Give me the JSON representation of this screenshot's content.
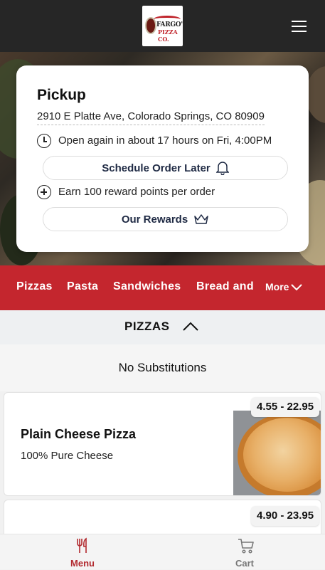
{
  "header": {
    "logo_line1": "FARGO'S",
    "logo_line2": "PIZZA CO.",
    "menu_icon": "hamburger-menu-icon"
  },
  "pickup_card": {
    "title": "Pickup",
    "address": "2910 E Platte Ave, Colorado Springs, CO 80909",
    "hours_text": "Open again in about 17 hours on Fri, 4:00PM",
    "hours_icon": "clock-icon",
    "schedule_button": "Schedule Order Later",
    "schedule_icon": "bell-icon",
    "rewards_text": "Earn 100 reward points per order",
    "rewards_icon": "plus-circle-icon",
    "rewards_button": "Our Rewards",
    "rewards_button_icon": "crown-icon"
  },
  "categories": {
    "items": [
      "Pizzas",
      "Pasta",
      "Sandwiches",
      "Bread and"
    ],
    "more_label": "More",
    "more_icon": "chevron-down-icon"
  },
  "section": {
    "title": "PIZZAS",
    "toggle_icon": "chevron-up-icon",
    "subtitle": "No Substitutions"
  },
  "menu_items": [
    {
      "name": "Plain Cheese Pizza",
      "description": "100% Pure Cheese",
      "price": "4.55 - 22.95"
    },
    {
      "name": "",
      "description": "",
      "price": "4.90 - 23.95"
    }
  ],
  "bottom_nav": {
    "menu_label": "Menu",
    "menu_icon": "fork-knife-icon",
    "cart_label": "Cart",
    "cart_icon": "cart-icon"
  },
  "colors": {
    "accent": "#c4262e",
    "topbar": "#262626",
    "nav_active": "#b22a2f",
    "nav_inactive": "#777777"
  }
}
